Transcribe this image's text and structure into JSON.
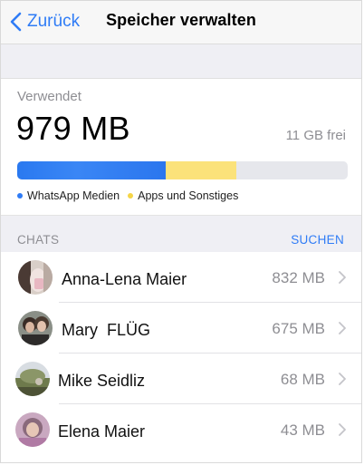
{
  "nav": {
    "back_label": "Zurück",
    "title": "Speicher verwalten"
  },
  "storage": {
    "used_label": "Verwendet",
    "used_value": "979 MB",
    "free_value": "11 GB frei",
    "bar": {
      "media_fraction": 0.45,
      "apps_fraction": 0.214,
      "media_color": "#2a79f0",
      "apps_color": "#fbe27a",
      "empty_color": "#e6e7ec"
    },
    "legend": [
      {
        "label": "WhatsApp Medien",
        "color": "#2f7cf6"
      },
      {
        "label": "Apps und Sonstiges",
        "color": "#f5d547"
      }
    ]
  },
  "chats_section": {
    "title": "CHATS",
    "action": "SUCHEN"
  },
  "chats": [
    {
      "name": "Anna-Lena Maier",
      "size": "832 MB"
    },
    {
      "name": "Mary  FLÜG",
      "size": "675 MB"
    },
    {
      "name": "Mike Seidliz",
      "size": "68 MB"
    },
    {
      "name": "Elena Maier",
      "size": "43 MB"
    }
  ],
  "colors": {
    "accent": "#2f7cf6",
    "secondary_text": "#8e8e93",
    "grouped_background": "#efeff4"
  }
}
